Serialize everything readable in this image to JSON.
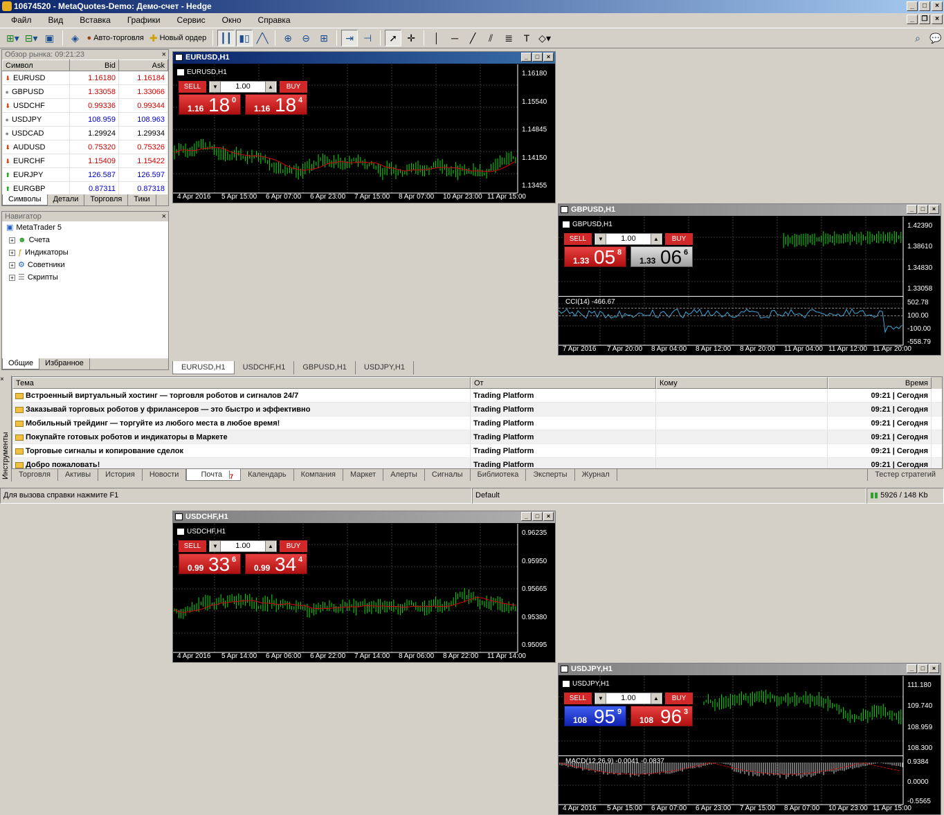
{
  "window": {
    "title": "10674520 - MetaQuotes-Demo: Демо-счет - Hedge"
  },
  "menu": [
    "Файл",
    "Вид",
    "Вставка",
    "Графики",
    "Сервис",
    "Окно",
    "Справка"
  ],
  "toolbar": {
    "autotrade": "Авто-торговля",
    "neworder": "Новый ордер"
  },
  "market_watch": {
    "title": "Обзор рынка: 09:21:23",
    "headers": {
      "symbol": "Символ",
      "bid": "Bid",
      "ask": "Ask"
    },
    "rows": [
      {
        "symbol": "EURUSD",
        "bid": "1.16180",
        "ask": "1.16184",
        "dir": "down",
        "color": "red"
      },
      {
        "symbol": "GBPUSD",
        "bid": "1.33058",
        "ask": "1.33066",
        "dir": "none",
        "color": "red"
      },
      {
        "symbol": "USDCHF",
        "bid": "0.99336",
        "ask": "0.99344",
        "dir": "down",
        "color": "red"
      },
      {
        "symbol": "USDJPY",
        "bid": "108.959",
        "ask": "108.963",
        "dir": "none",
        "color": "blue"
      },
      {
        "symbol": "USDCAD",
        "bid": "1.29924",
        "ask": "1.29934",
        "dir": "none",
        "color": "black"
      },
      {
        "symbol": "AUDUSD",
        "bid": "0.75320",
        "ask": "0.75326",
        "dir": "down",
        "color": "red"
      },
      {
        "symbol": "EURCHF",
        "bid": "1.15409",
        "ask": "1.15422",
        "dir": "down",
        "color": "red"
      },
      {
        "symbol": "EURJPY",
        "bid": "126.587",
        "ask": "126.597",
        "dir": "up",
        "color": "blue"
      },
      {
        "symbol": "EURGBP",
        "bid": "0.87311",
        "ask": "0.87318",
        "dir": "up",
        "color": "blue"
      }
    ],
    "tabs": [
      "Символы",
      "Детали",
      "Торговля",
      "Тики"
    ]
  },
  "navigator": {
    "title": "Навигатор",
    "root": "MetaTrader 5",
    "items": [
      "Счета",
      "Индикаторы",
      "Советники",
      "Скрипты"
    ],
    "tabs": [
      "Общие",
      "Избранное"
    ]
  },
  "charts": [
    {
      "title": "EURUSD,H1",
      "sub": "EURUSD,H1",
      "sell": "SELL",
      "buy": "BUY",
      "lot": "1.00",
      "sell_small": "1.16",
      "sell_big": "18",
      "sell_sup": "0",
      "buy_small": "1.16",
      "buy_big": "18",
      "buy_sup": "4",
      "y": [
        "1.16180",
        "1.15540",
        "1.14845",
        "1.14150",
        "1.13455"
      ],
      "x": [
        "4 Apr 2016",
        "5 Apr 15:00",
        "6 Apr 07:00",
        "6 Apr 23:00",
        "7 Apr 15:00",
        "8 Apr 07:00",
        "10 Apr 23:00",
        "11 Apr 15:00"
      ]
    },
    {
      "title": "GBPUSD,H1",
      "sub": "GBPUSD,H1",
      "sell": "SELL",
      "buy": "BUY",
      "lot": "1.00",
      "sell_small": "1.33",
      "sell_big": "05",
      "sell_sup": "8",
      "buy_small": "1.33",
      "buy_big": "06",
      "buy_sup": "6",
      "y": [
        "1.42390",
        "1.38610",
        "1.34830",
        "1.33058"
      ],
      "ind": "CCI(14) -466.67",
      "iy": [
        "502.78",
        "100.00",
        "-100.00",
        "-558.79"
      ],
      "x": [
        "7 Apr 2016",
        "7 Apr 20:00",
        "8 Apr 04:00",
        "8 Apr 12:00",
        "8 Apr 20:00",
        "11 Apr 04:00",
        "11 Apr 12:00",
        "11 Apr 20:00"
      ]
    },
    {
      "title": "USDCHF,H1",
      "sub": "USDCHF,H1",
      "sell": "SELL",
      "buy": "BUY",
      "lot": "1.00",
      "sell_small": "0.99",
      "sell_big": "33",
      "sell_sup": "6",
      "buy_small": "0.99",
      "buy_big": "34",
      "buy_sup": "4",
      "y": [
        "0.96235",
        "0.95950",
        "0.95665",
        "0.95380",
        "0.95095"
      ],
      "x": [
        "4 Apr 2016",
        "5 Apr 14:00",
        "6 Apr 06:00",
        "6 Apr 22:00",
        "7 Apr 14:00",
        "8 Apr 06:00",
        "8 Apr 22:00",
        "11 Apr 14:00"
      ]
    },
    {
      "title": "USDJPY,H1",
      "sub": "USDJPY,H1",
      "sell": "SELL",
      "buy": "BUY",
      "lot": "1.00",
      "sell_small": "108",
      "sell_big": "95",
      "sell_sup": "9",
      "buy_small": "108",
      "buy_big": "96",
      "buy_sup": "3",
      "y": [
        "111.180",
        "109.740",
        "108.959",
        "108.300"
      ],
      "ind": "MACD(12,26,9) -0.0041 -0.0837",
      "iy": [
        "0.9384",
        "0.0000",
        "-0.5565"
      ],
      "x": [
        "4 Apr 2016",
        "5 Apr 15:00",
        "6 Apr 07:00",
        "6 Apr 23:00",
        "7 Apr 15:00",
        "8 Apr 07:00",
        "10 Apr 23:00",
        "11 Apr 15:00"
      ]
    }
  ],
  "chart_tabs": [
    "EURUSD,H1",
    "USDCHF,H1",
    "GBPUSD,H1",
    "USDJPY,H1"
  ],
  "mail": {
    "headers": {
      "subject": "Тема",
      "from": "От",
      "to": "Кому",
      "time": "Время"
    },
    "rows": [
      {
        "subject": "Встроенный виртуальный хостинг — торговля роботов и сигналов 24/7",
        "from": "Trading Platform",
        "time": "09:21 | Сегодня"
      },
      {
        "subject": "Заказывай торговых роботов у фрилансеров — это быстро и эффективно",
        "from": "Trading Platform",
        "time": "09:21 | Сегодня"
      },
      {
        "subject": "Мобильный трейдинг — торгуйте из любого места в любое время!",
        "from": "Trading Platform",
        "time": "09:21 | Сегодня"
      },
      {
        "subject": "Покупайте готовых роботов и индикаторы в Маркете",
        "from": "Trading Platform",
        "time": "09:21 | Сегодня"
      },
      {
        "subject": "Торговые сигналы и копирование сделок",
        "from": "Trading Platform",
        "time": "09:21 | Сегодня"
      },
      {
        "subject": "Добро пожаловать!",
        "from": "Trading Platform",
        "time": "09:21 | Сегодня"
      }
    ]
  },
  "toolbox_label": "Инструменты",
  "bottom_tabs": [
    "Торговля",
    "Активы",
    "История",
    "Новости",
    "Почта",
    "Календарь",
    "Компания",
    "Маркет",
    "Алерты",
    "Сигналы",
    "Библиотека",
    "Эксперты",
    "Журнал"
  ],
  "mail_badge": "7",
  "tester": "Тестер стратегий",
  "status": {
    "help": "Для вызова справки нажмите F1",
    "profile": "Default",
    "traffic": "5926 / 148 Kb"
  }
}
